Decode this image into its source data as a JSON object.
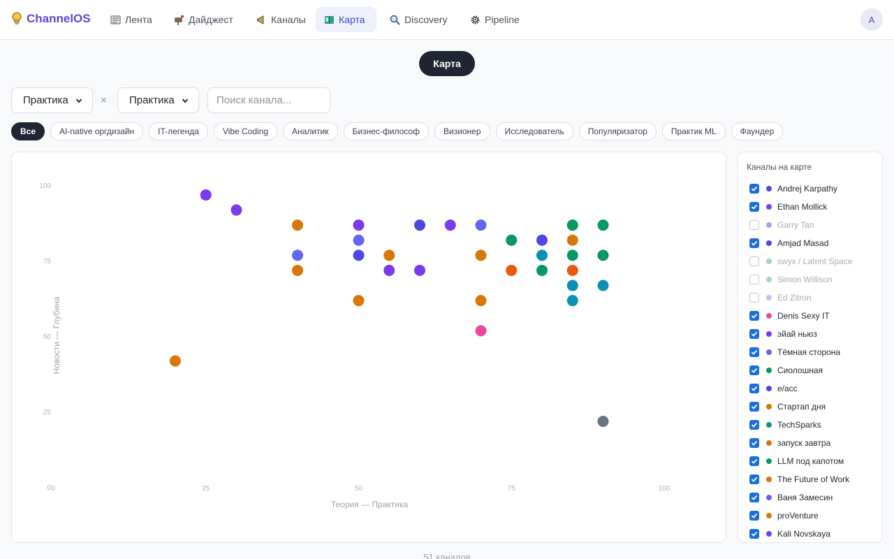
{
  "app": {
    "name": "ChannelOS"
  },
  "nav": [
    {
      "id": "feed",
      "label": "Лента",
      "icon": "newspaper-icon",
      "active": false
    },
    {
      "id": "digest",
      "label": "Дайджест",
      "icon": "mailbox-icon",
      "active": false
    },
    {
      "id": "channels",
      "label": "Каналы",
      "icon": "megaphone-icon",
      "active": false
    },
    {
      "id": "map",
      "label": "Карта",
      "icon": "map-book-icon",
      "active": true
    },
    {
      "id": "discovery",
      "label": "Discovery",
      "icon": "magnifier-icon",
      "active": false
    },
    {
      "id": "pipeline",
      "label": "Pipeline",
      "icon": "gear-icon",
      "active": false
    }
  ],
  "user": {
    "initial": "A"
  },
  "view_toggle": {
    "label": "Карта"
  },
  "filters": {
    "x_axis_select": "Практика",
    "separator": "×",
    "y_axis_select": "Практика",
    "search_placeholder": "Поиск канала..."
  },
  "chips": [
    {
      "label": "Все",
      "active": true
    },
    {
      "label": "AI-native оргдизайн",
      "active": false
    },
    {
      "label": "IT-легенда",
      "active": false
    },
    {
      "label": "Vibe Coding",
      "active": false
    },
    {
      "label": "Аналитик",
      "active": false
    },
    {
      "label": "Бизнес-философ",
      "active": false
    },
    {
      "label": "Визионер",
      "active": false
    },
    {
      "label": "Исследователь",
      "active": false
    },
    {
      "label": "Популяризатор",
      "active": false
    },
    {
      "label": "Практик ML",
      "active": false
    },
    {
      "label": "Фаундер",
      "active": false
    }
  ],
  "chart_data": {
    "type": "scatter",
    "xlabel": "Теория — Практика",
    "ylabel": "Новости — Глубина",
    "xlim": [
      0,
      100
    ],
    "ylim": [
      0,
      100
    ],
    "x_ticks": [
      0,
      25,
      50,
      75,
      100
    ],
    "y_ticks": [
      0,
      25,
      50,
      75,
      100
    ],
    "grid": false,
    "points": [
      {
        "x": 25,
        "y": 97,
        "color": "#7c3aed"
      },
      {
        "x": 30,
        "y": 92,
        "color": "#7c3aed"
      },
      {
        "x": 40,
        "y": 87,
        "color": "#d97706"
      },
      {
        "x": 50,
        "y": 87,
        "color": "#7c3aed"
      },
      {
        "x": 60,
        "y": 87,
        "color": "#4f46e5"
      },
      {
        "x": 65,
        "y": 87,
        "color": "#7c3aed"
      },
      {
        "x": 70,
        "y": 87,
        "color": "#6366f1"
      },
      {
        "x": 85,
        "y": 87,
        "color": "#059669"
      },
      {
        "x": 90,
        "y": 87,
        "color": "#059669"
      },
      {
        "x": 50,
        "y": 82,
        "color": "#6366f1"
      },
      {
        "x": 75,
        "y": 82,
        "color": "#059669"
      },
      {
        "x": 80,
        "y": 82,
        "color": "#4f46e5"
      },
      {
        "x": 85,
        "y": 82,
        "color": "#d97706"
      },
      {
        "x": 40,
        "y": 77,
        "color": "#6366f1"
      },
      {
        "x": 50,
        "y": 77,
        "color": "#4f46e5"
      },
      {
        "x": 55,
        "y": 77,
        "color": "#d97706"
      },
      {
        "x": 70,
        "y": 77,
        "color": "#d97706"
      },
      {
        "x": 80,
        "y": 77,
        "color": "#0891b2"
      },
      {
        "x": 85,
        "y": 77,
        "color": "#059669"
      },
      {
        "x": 90,
        "y": 77,
        "color": "#059669"
      },
      {
        "x": 40,
        "y": 72,
        "color": "#d97706"
      },
      {
        "x": 55,
        "y": 72,
        "color": "#7c3aed"
      },
      {
        "x": 60,
        "y": 72,
        "color": "#7c3aed"
      },
      {
        "x": 75,
        "y": 72,
        "color": "#ea580c"
      },
      {
        "x": 80,
        "y": 72,
        "color": "#059669"
      },
      {
        "x": 85,
        "y": 72,
        "color": "#ea580c"
      },
      {
        "x": 85,
        "y": 67,
        "color": "#0891b2"
      },
      {
        "x": 90,
        "y": 67,
        "color": "#0891b2"
      },
      {
        "x": 50,
        "y": 62,
        "color": "#d97706"
      },
      {
        "x": 70,
        "y": 62,
        "color": "#d97706"
      },
      {
        "x": 85,
        "y": 62,
        "color": "#0891b2"
      },
      {
        "x": 70,
        "y": 52,
        "color": "#ec4899"
      },
      {
        "x": 20,
        "y": 42,
        "color": "#d97706"
      },
      {
        "x": 90,
        "y": 22,
        "color": "#6b7280"
      }
    ]
  },
  "legend": {
    "title": "Каналы на карте",
    "items": [
      {
        "name": "Andrej Karpathy",
        "checked": true,
        "color": "#4f46e5"
      },
      {
        "name": "Ethan Mollick",
        "checked": true,
        "color": "#7c3aed"
      },
      {
        "name": "Garry Tan",
        "checked": false,
        "color": "#a5a8e8"
      },
      {
        "name": "Amjad Masad",
        "checked": true,
        "color": "#4f46e5"
      },
      {
        "name": "swyx / Latent Space",
        "checked": false,
        "color": "#9fd8c4"
      },
      {
        "name": "Simon Willison",
        "checked": false,
        "color": "#9fd8c4"
      },
      {
        "name": "Ed Zitron",
        "checked": false,
        "color": "#bfc3f0"
      },
      {
        "name": "Denis Sexy IT",
        "checked": true,
        "color": "#ec4899"
      },
      {
        "name": "эйай ньюз",
        "checked": true,
        "color": "#7c3aed"
      },
      {
        "name": "Тёмная сторона",
        "checked": true,
        "color": "#6366f1"
      },
      {
        "name": "Сиолошная",
        "checked": true,
        "color": "#059669"
      },
      {
        "name": "e/acc",
        "checked": true,
        "color": "#4f46e5"
      },
      {
        "name": "Стартап дня",
        "checked": true,
        "color": "#d97706"
      },
      {
        "name": "TechSparks",
        "checked": true,
        "color": "#0d9488"
      },
      {
        "name": "запуск завтра",
        "checked": true,
        "color": "#d97706"
      },
      {
        "name": "LLM под капотом",
        "checked": true,
        "color": "#059669"
      },
      {
        "name": "The Future of Work",
        "checked": true,
        "color": "#d97706"
      },
      {
        "name": "Ваня Замесин",
        "checked": true,
        "color": "#6366f1"
      },
      {
        "name": "proVenture",
        "checked": true,
        "color": "#d97706"
      },
      {
        "name": "Kali Novskaya",
        "checked": true,
        "color": "#7c3aed"
      }
    ]
  },
  "footer": {
    "count_label": "51 каналов"
  }
}
